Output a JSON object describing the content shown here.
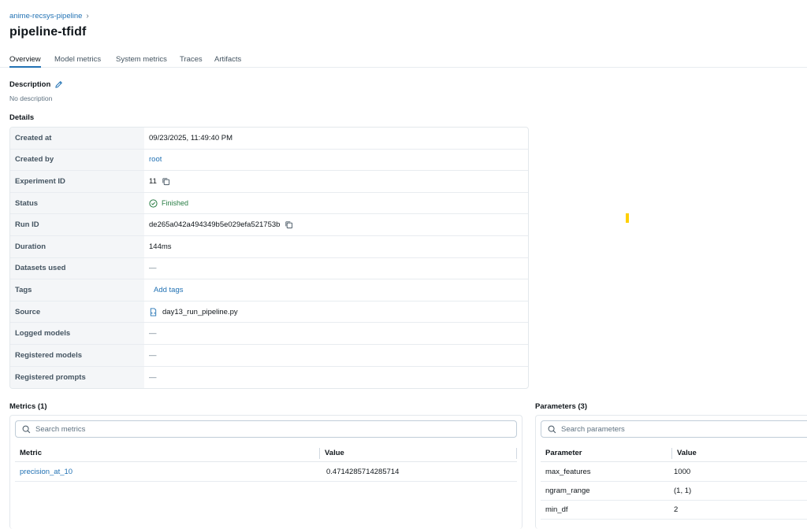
{
  "breadcrumb": {
    "experiment": "anime-recsys-pipeline",
    "separator": "›"
  },
  "page_title": "pipeline-tfidf",
  "tabs": [
    "Overview",
    "Model metrics",
    "System metrics",
    "Traces",
    "Artifacts"
  ],
  "active_tab": "Overview",
  "description": {
    "label": "Description",
    "value": "No description"
  },
  "details": {
    "label": "Details",
    "rows": [
      {
        "key": "Created at",
        "value": "09/23/2025, 11:49:40 PM"
      },
      {
        "key": "Created by",
        "value": "root"
      },
      {
        "key": "Experiment ID",
        "value": "11"
      },
      {
        "key": "Status",
        "value": "Finished"
      },
      {
        "key": "Run ID",
        "value": "de265a042a494349b5e029efa521753b"
      },
      {
        "key": "Duration",
        "value": "144ms"
      },
      {
        "key": "Datasets used",
        "value": "—"
      },
      {
        "key": "Tags",
        "value": "Add tags"
      },
      {
        "key": "Source",
        "value": "day13_run_pipeline.py"
      },
      {
        "key": "Logged models",
        "value": "—"
      },
      {
        "key": "Registered models",
        "value": "—"
      },
      {
        "key": "Registered prompts",
        "value": "—"
      }
    ]
  },
  "metrics": {
    "title": "Metrics (1)",
    "search_placeholder": "Search metrics",
    "columns": [
      "Metric",
      "Value"
    ],
    "rows": [
      {
        "name": "precision_at_10",
        "value": "0.4714285714285714"
      }
    ]
  },
  "parameters": {
    "title": "Parameters (3)",
    "search_placeholder": "Search parameters",
    "columns": [
      "Parameter",
      "Value"
    ],
    "rows": [
      {
        "name": "max_features",
        "value": "1000"
      },
      {
        "name": "ngram_range",
        "value": "(1, 1)"
      },
      {
        "name": "min_df",
        "value": "2"
      }
    ]
  },
  "colors": {
    "link": "#2272b4",
    "success": "#277c43",
    "key_bg": "#f4f6f8",
    "highlight": "#ffd000"
  },
  "icons": [
    "pencil-icon",
    "copy-icon",
    "check-circle-icon",
    "file-code-icon",
    "search-icon"
  ]
}
